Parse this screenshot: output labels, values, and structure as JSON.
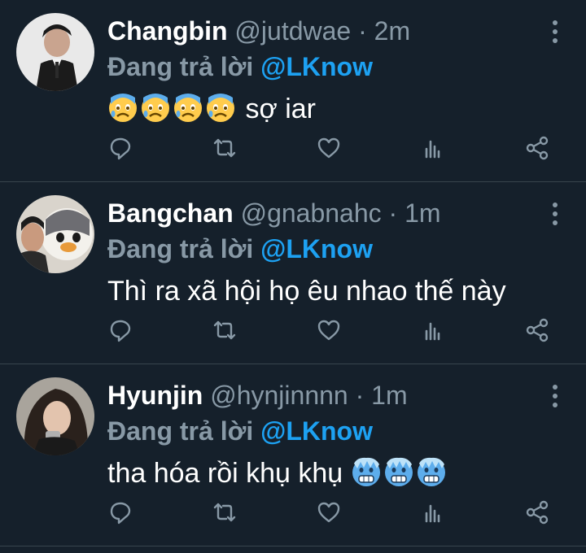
{
  "reply_prefix": "Đang trả lời",
  "colors": {
    "background": "#15202b",
    "secondary_text": "#8899a6",
    "mention": "#1da1f2",
    "divider": "#38444d"
  },
  "tweets": [
    {
      "name": "Changbin",
      "handle": "@jutdwae",
      "time": "2m",
      "mention": "@LKnow",
      "text": "sợ iar",
      "emoji": "anxious-face-with-sweat",
      "emoji_count": 4,
      "emoji_position": "before"
    },
    {
      "name": "Bangchan",
      "handle": "@gnabnahc",
      "time": "1m",
      "mention": "@LKnow",
      "text": "Thì ra xã hội họ êu nhao thế này",
      "emoji": "",
      "emoji_count": 0,
      "emoji_position": "none"
    },
    {
      "name": "Hyunjin",
      "handle": "@hynjinnnn",
      "time": "1m",
      "mention": "@LKnow",
      "text": "tha hóa rồi khụ khụ",
      "emoji": "cold-face",
      "emoji_count": 3,
      "emoji_position": "after"
    }
  ],
  "action_icons": [
    "reply-icon",
    "retweet-icon",
    "like-icon",
    "analytics-icon",
    "share-icon"
  ]
}
